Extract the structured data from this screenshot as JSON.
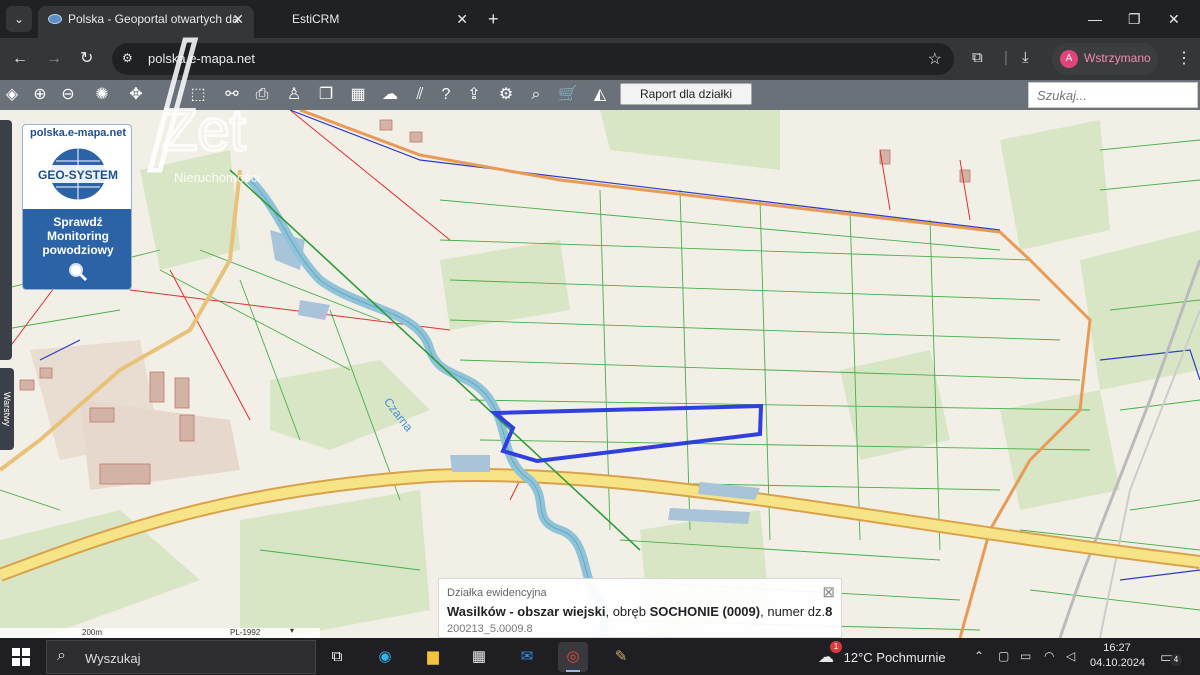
{
  "browser": {
    "tabs": [
      {
        "title": "Polska - Geoportal otwartych da",
        "active": true
      },
      {
        "title": "EstiCRM",
        "active": false
      }
    ],
    "url": "polska.e-mapa.net",
    "profile_status": "Wstrzymano",
    "profile_initial": "A"
  },
  "toolbar": {
    "report_button": "Raport dla działki",
    "search_placeholder": "Szukaj..."
  },
  "map": {
    "logo_site": "polska.e-mapa.net",
    "logo_brand": "GEO-SYSTEM",
    "flood_monitor_label": [
      "Sprawdź",
      "Monitoring",
      "powodziowy"
    ],
    "side_panel_label": "Warstwy",
    "river_label": "Czarna",
    "watermark_text": "Zet",
    "watermark_subtext": "Nieruchomości",
    "scale_label": "200m",
    "crs_label": "PL-1992"
  },
  "parcel_info": {
    "title": "Działka ewidencyjna",
    "area_name": "Wasilków - obszar wiejski",
    "sep1": ", obręb ",
    "precinct": "SOCHONIE (0009)",
    "sep2": ", numer dz.",
    "parcel_number": "8",
    "parcel_id": "200213_5.0009.8"
  },
  "taskbar": {
    "search_label": "Wyszukaj",
    "weather": "12°C  Pochmurnie",
    "weather_badge": "1",
    "time": "16:27",
    "date": "04.10.2024",
    "notification_count": "4"
  },
  "colors": {
    "parcel_outline": "#2f3fe0",
    "road": "#f2d873",
    "river": "#8fc3d8",
    "vegetation": "#d9e6c6",
    "toolbar": "#6b7179"
  }
}
